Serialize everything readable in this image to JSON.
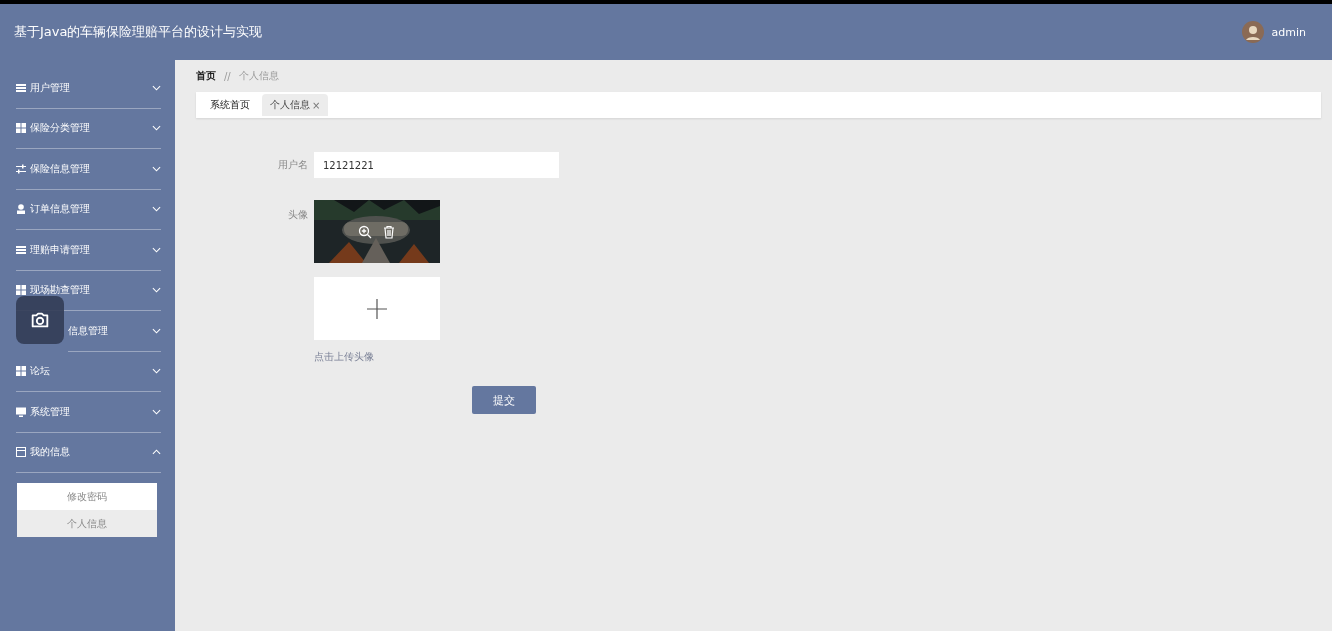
{
  "header": {
    "title": "基于Java的车辆保险理赔平台的设计与实现",
    "user": "admin"
  },
  "sidebar": {
    "items": [
      {
        "label": "用户管理",
        "kind": "list",
        "expanded": false
      },
      {
        "label": "保险分类管理",
        "kind": "grid",
        "expanded": false
      },
      {
        "label": "保险信息管理",
        "kind": "sliders",
        "expanded": false
      },
      {
        "label": "订单信息管理",
        "kind": "person",
        "expanded": false
      },
      {
        "label": "理赔申请管理",
        "kind": "list",
        "expanded": false
      },
      {
        "label": "现场勘查管理",
        "kind": "grid",
        "expanded": false
      },
      {
        "label": "信息管理",
        "kind": "covered",
        "expanded": false
      },
      {
        "label": "论坛",
        "kind": "grid",
        "expanded": false
      },
      {
        "label": "系统管理",
        "kind": "monitor",
        "expanded": false
      },
      {
        "label": "我的信息",
        "kind": "card",
        "expanded": true,
        "children": [
          {
            "label": "修改密码",
            "selected": false
          },
          {
            "label": "个人信息",
            "selected": true
          }
        ]
      }
    ]
  },
  "breadcrumb": [
    "首页",
    "//",
    "个人信息"
  ],
  "tabs": [
    {
      "label": "系统首页",
      "selected": false
    },
    {
      "label": "个人信息",
      "selected": true,
      "close": "×"
    }
  ],
  "form": {
    "username_label": "用户名",
    "username": "12121221",
    "avatar_label": "头像",
    "upload_hint": "点击上传头像",
    "submit": "提交"
  }
}
